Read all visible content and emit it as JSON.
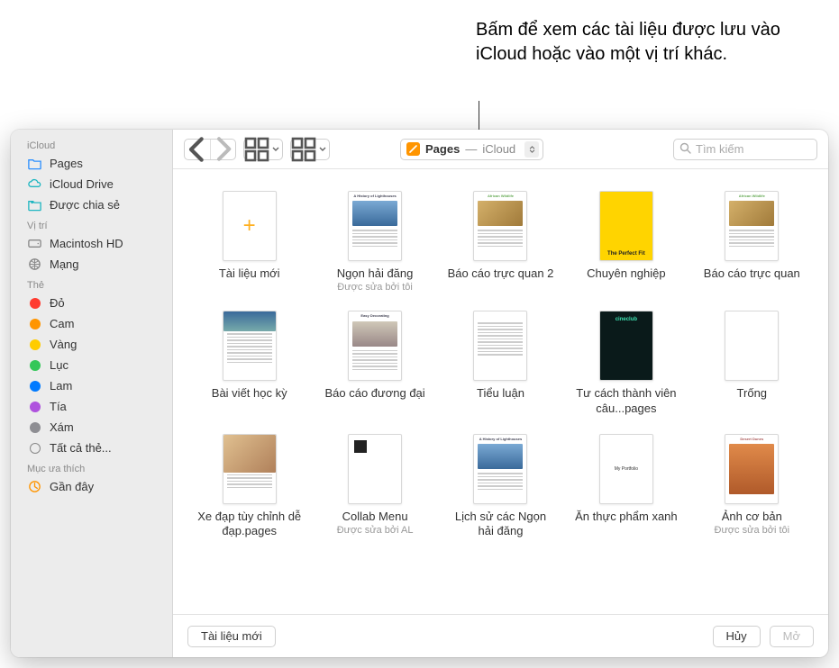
{
  "callout": "Bấm để xem các tài liệu được lưu vào iCloud hoặc vào một vị trí khác.",
  "path": {
    "app": "Pages",
    "location": "iCloud"
  },
  "search": {
    "placeholder": "Tìm kiếm"
  },
  "sidebar": {
    "sections": [
      {
        "header": "iCloud",
        "items": [
          {
            "label": "Pages",
            "icon": "folder"
          },
          {
            "label": "iCloud Drive",
            "icon": "cloud"
          },
          {
            "label": "Được chia sẻ",
            "icon": "shared"
          }
        ]
      },
      {
        "header": "Vị trí",
        "items": [
          {
            "label": "Macintosh HD",
            "icon": "disk"
          },
          {
            "label": "Mạng",
            "icon": "globe"
          }
        ]
      },
      {
        "header": "Thẻ",
        "items": [
          {
            "label": "Đỏ",
            "color": "#ff3b30"
          },
          {
            "label": "Cam",
            "color": "#ff9500"
          },
          {
            "label": "Vàng",
            "color": "#ffcc00"
          },
          {
            "label": "Lục",
            "color": "#34c759"
          },
          {
            "label": "Lam",
            "color": "#007aff"
          },
          {
            "label": "Tía",
            "color": "#af52de"
          },
          {
            "label": "Xám",
            "color": "#8e8e93"
          },
          {
            "label": "Tất cả thẻ...",
            "outline": true
          }
        ]
      },
      {
        "header": "Mục ưa thích",
        "items": [
          {
            "label": "Gần đây",
            "icon": "clock"
          }
        ]
      }
    ]
  },
  "docs": [
    {
      "label": "Tài liệu mới",
      "kind": "new"
    },
    {
      "label": "Ngọn hải đăng",
      "sub": "Được sửa bởi tôi",
      "kind": "lighthouse"
    },
    {
      "label": "Báo cáo trực quan 2",
      "kind": "wildlife"
    },
    {
      "label": "Chuyên nghiệp",
      "kind": "perfectfit"
    },
    {
      "label": "Báo cáo trực quan",
      "kind": "wildlife"
    },
    {
      "label": "Bài viết học kỳ",
      "kind": "essay"
    },
    {
      "label": "Báo cáo đương đại",
      "kind": "decor"
    },
    {
      "label": "Tiểu luận",
      "kind": "textonly"
    },
    {
      "label": "Tư cách thành viên câu...pages",
      "kind": "cine"
    },
    {
      "label": "Trống",
      "kind": "blank"
    },
    {
      "label": "Xe đạp tùy chỉnh dễ đạp.pages",
      "kind": "bike"
    },
    {
      "label": "Collab Menu",
      "sub": "Được sửa bởi AL",
      "kind": "menu"
    },
    {
      "label": "Lịch sử các Ngọn hải đăng",
      "kind": "lighthouse"
    },
    {
      "label": "Ăn thực phẩm xanh",
      "kind": "portfolio"
    },
    {
      "label": "Ảnh cơ bản",
      "sub": "Được sửa bởi tôi",
      "kind": "dunes"
    }
  ],
  "footer": {
    "newdoc": "Tài liệu mới",
    "cancel": "Hủy",
    "open": "Mở"
  },
  "thumb_text": {
    "lighthouse_title": "A History of Lighthouses",
    "wildlife_title": "African Wildlife",
    "perfectfit_title": "The Perfect Fit",
    "decor_title": "Easy Decorating",
    "portfolio_title": "My Portfolio",
    "dunes_title": "Desert Dunes",
    "cine_title": "cineclub"
  }
}
